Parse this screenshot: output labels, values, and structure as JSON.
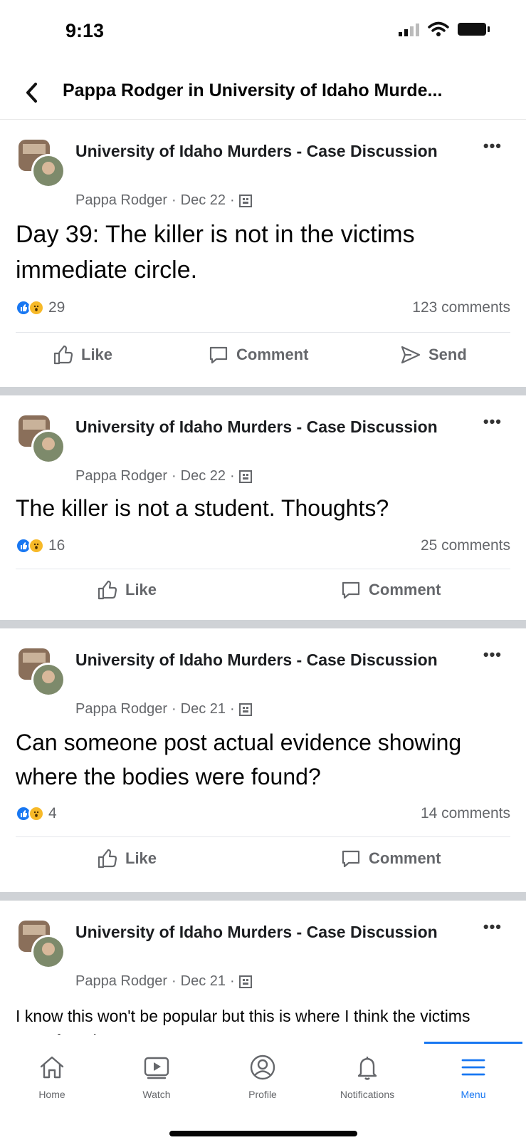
{
  "status_bar": {
    "time": "9:13"
  },
  "header": {
    "title": "Pappa Rodger in University of Idaho Murde..."
  },
  "posts": [
    {
      "group": "University of Idaho Murders - Case Discussion",
      "author": "Pappa Rodger",
      "date": "Dec 22",
      "text": "Day 39:  The killer is not in the victims immediate circle.",
      "reactions": "29",
      "comments": "123 comments",
      "actions": [
        "Like",
        "Comment",
        "Send"
      ]
    },
    {
      "group": "University of Idaho Murders - Case Discussion",
      "author": "Pappa Rodger",
      "date": "Dec 22",
      "text": "The killer is not a student.  Thoughts?",
      "reactions": "16",
      "comments": "25 comments",
      "actions": [
        "Like",
        "Comment"
      ]
    },
    {
      "group": "University of Idaho Murders - Case Discussion",
      "author": "Pappa Rodger",
      "date": "Dec 21",
      "text": "Can someone post actual evidence showing where the bodies were found?",
      "reactions": "4",
      "comments": "14 comments",
      "actions": [
        "Like",
        "Comment"
      ]
    },
    {
      "group": "University of Idaho Murders - Case Discussion",
      "author": "Pappa Rodger",
      "date": "Dec 21",
      "text": "I know this won't be popular but this is where I think the victims were found."
    }
  ],
  "meta_separator": "·",
  "more_glyph": "•••",
  "tabbar": {
    "tabs": [
      {
        "label": "Home",
        "icon": "home-icon"
      },
      {
        "label": "Watch",
        "icon": "watch-icon"
      },
      {
        "label": "Profile",
        "icon": "profile-icon"
      },
      {
        "label": "Notifications",
        "icon": "bell-icon"
      },
      {
        "label": "Menu",
        "icon": "menu-icon",
        "active": true
      }
    ]
  },
  "colors": {
    "accent": "#1877f2",
    "secondary_text": "#65676b",
    "separator": "#cfd2d6"
  }
}
